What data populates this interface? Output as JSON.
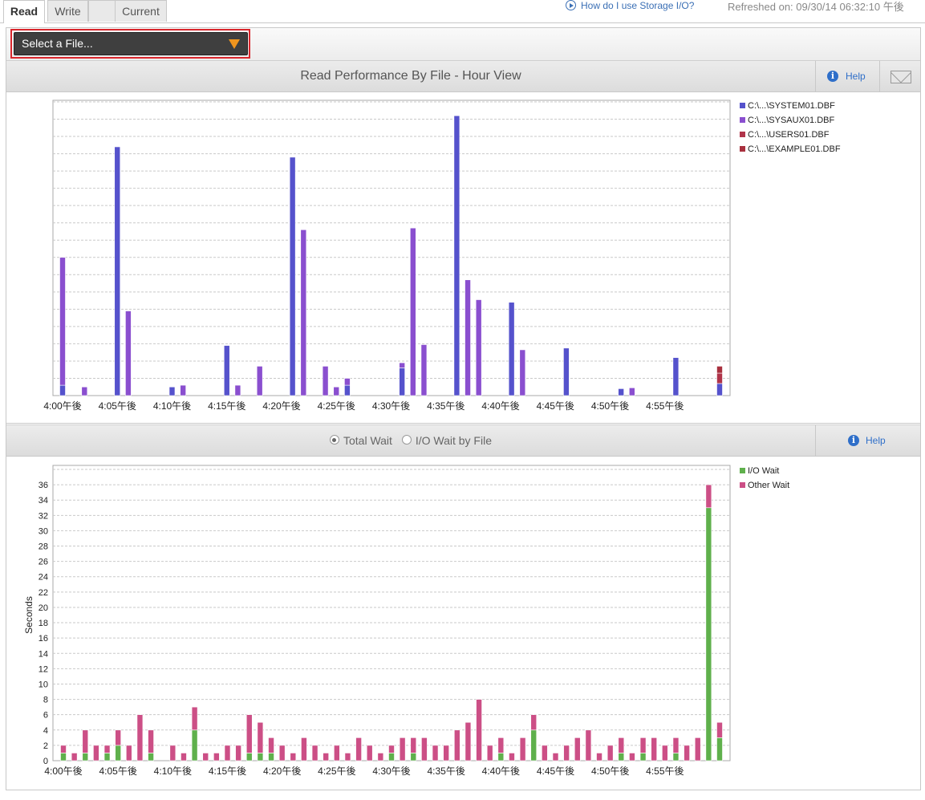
{
  "tabs": [
    {
      "label": "Read",
      "active": true
    },
    {
      "label": "Write",
      "active": false
    },
    {
      "label": "",
      "active": false
    },
    {
      "label": "Current",
      "active": false
    }
  ],
  "header": {
    "howto_label": "How do I use Storage I/O?",
    "refreshed": "Refreshed on: 09/30/14 06:32:10 午後"
  },
  "file_select": {
    "label": "Select a File..."
  },
  "read_panel": {
    "title": "Read Performance By File - Hour View",
    "help_label": "Help"
  },
  "wait_panel": {
    "radio_total": "Total Wait",
    "radio_by_file": "I/O Wait by File",
    "selected": "Total Wait",
    "help_label": "Help"
  },
  "colors": {
    "system": "#5552cc",
    "sysaux": "#8a4fcf",
    "users": "#b0344a",
    "example": "#a8303e",
    "io_wait": "#5fb04c",
    "other_wait": "#cc4f86"
  },
  "chart_data": [
    {
      "type": "bar",
      "title": "",
      "x_tick_labels": [
        "4:00午後",
        "4:05午後",
        "4:10午後",
        "4:15午後",
        "4:20午後",
        "4:25午後",
        "4:30午後",
        "4:35午後",
        "4:40午後",
        "4:45午後",
        "4:50午後",
        "4:55午後"
      ],
      "y_tick_labels_shown": false,
      "ylim": [
        0,
        17
      ],
      "grid": true,
      "legend_position": "top-right",
      "minutes": [
        0,
        1,
        2,
        3,
        4,
        5,
        6,
        7,
        8,
        9,
        10,
        11,
        12,
        13,
        14,
        15,
        16,
        17,
        18,
        19,
        20,
        21,
        22,
        23,
        24,
        25,
        26,
        27,
        28,
        29,
        30,
        31,
        32,
        33,
        34,
        35,
        36,
        37,
        38,
        39,
        40,
        41,
        42,
        43,
        44,
        45,
        46,
        47,
        48,
        49,
        50,
        51,
        52,
        53,
        54,
        55,
        56,
        57,
        58,
        59,
        60
      ],
      "series": [
        {
          "name": "C:\\...\\SYSTEM01.DBF",
          "values": [
            0.6,
            0,
            0,
            0,
            0,
            14.4,
            0,
            0,
            0,
            0,
            0.5,
            0,
            0,
            0,
            0,
            2.9,
            0,
            0,
            0,
            0,
            0,
            13.8,
            0,
            0,
            0,
            0,
            0.6,
            0,
            0,
            0,
            0,
            1.6,
            0,
            0,
            0,
            0,
            16.2,
            0,
            0,
            0,
            0,
            5.4,
            0,
            0,
            0,
            0,
            2.75,
            0,
            0,
            0,
            0,
            0.4,
            0,
            0,
            0,
            0,
            2.2,
            0,
            0,
            0,
            0.7
          ]
        },
        {
          "name": "C:\\...\\SYSAUX01.DBF",
          "values": [
            7.4,
            0,
            0.5,
            0,
            0,
            0,
            4.9,
            0,
            0,
            0,
            0,
            0.6,
            0,
            0,
            0,
            0,
            0.6,
            0,
            1.7,
            0,
            0,
            0,
            9.6,
            0,
            1.7,
            0.5,
            0.4,
            0,
            0,
            0,
            0,
            0.3,
            9.7,
            2.95,
            0,
            0,
            0,
            6.7,
            5.55,
            0,
            0,
            0,
            2.65,
            0,
            0,
            0,
            0,
            0,
            0,
            0,
            0,
            0,
            0.45,
            0,
            0,
            0,
            0,
            0,
            0,
            0,
            0
          ]
        },
        {
          "name": "C:\\...\\USERS01.DBF",
          "values": [
            0,
            0,
            0,
            0,
            0,
            0,
            0,
            0,
            0,
            0,
            0,
            0,
            0,
            0,
            0,
            0,
            0,
            0,
            0,
            0,
            0,
            0,
            0,
            0,
            0,
            0,
            0,
            0,
            0,
            0,
            0,
            0,
            0,
            0,
            0,
            0,
            0,
            0,
            0,
            0,
            0,
            0,
            0,
            0,
            0,
            0,
            0,
            0,
            0,
            0,
            0,
            0,
            0,
            0,
            0,
            0,
            0,
            0,
            0,
            0,
            0.6
          ]
        },
        {
          "name": "C:\\...\\EXAMPLE01.DBF",
          "values": [
            0,
            0,
            0,
            0,
            0,
            0,
            0,
            0,
            0,
            0,
            0,
            0,
            0,
            0,
            0,
            0,
            0,
            0,
            0,
            0,
            0,
            0,
            0,
            0,
            0,
            0,
            0,
            0,
            0,
            0,
            0,
            0,
            0,
            0,
            0,
            0,
            0,
            0,
            0,
            0,
            0,
            0,
            0,
            0,
            0,
            0,
            0,
            0,
            0,
            0,
            0,
            0,
            0,
            0,
            0,
            0,
            0,
            0,
            0,
            0,
            0.4
          ]
        }
      ]
    },
    {
      "type": "bar",
      "title": "",
      "ylabel": "Seconds",
      "ylim": [
        0,
        38
      ],
      "yticks": [
        0,
        2,
        4,
        6,
        8,
        10,
        12,
        14,
        16,
        18,
        20,
        22,
        24,
        26,
        28,
        30,
        32,
        34,
        36
      ],
      "x_tick_labels": [
        "4:00午後",
        "4:05午後",
        "4:10午後",
        "4:15午後",
        "4:20午後",
        "4:25午後",
        "4:30午後",
        "4:35午後",
        "4:40午後",
        "4:45午後",
        "4:50午後",
        "4:55午後"
      ],
      "grid": true,
      "legend_position": "top-right",
      "minutes": [
        0,
        1,
        2,
        3,
        4,
        5,
        6,
        7,
        8,
        9,
        10,
        11,
        12,
        13,
        14,
        15,
        16,
        17,
        18,
        19,
        20,
        21,
        22,
        23,
        24,
        25,
        26,
        27,
        28,
        29,
        30,
        31,
        32,
        33,
        34,
        35,
        36,
        37,
        38,
        39,
        40,
        41,
        42,
        43,
        44,
        45,
        46,
        47,
        48,
        49,
        50,
        51,
        52,
        53,
        54,
        55,
        56,
        57,
        58,
        59,
        60
      ],
      "series": [
        {
          "name": "I/O Wait",
          "values": [
            1,
            0,
            1,
            0,
            1,
            2,
            0,
            0,
            1,
            0,
            0,
            0,
            4,
            0,
            0,
            0,
            0,
            1,
            1,
            1,
            0,
            0,
            0,
            0,
            0,
            0,
            0,
            0,
            0,
            0,
            1,
            0,
            1,
            0,
            0,
            0,
            0,
            0,
            0,
            0,
            1,
            0,
            0,
            4,
            0,
            0,
            0,
            0,
            0,
            0,
            0,
            1,
            0,
            1,
            0,
            0,
            1,
            0,
            0,
            33,
            3
          ]
        },
        {
          "name": "Other Wait",
          "values": [
            1,
            1,
            3,
            2,
            1,
            2,
            2,
            6,
            3,
            0,
            2,
            1,
            3,
            1,
            1,
            2,
            2,
            5,
            4,
            2,
            2,
            1,
            3,
            2,
            1,
            2,
            1,
            3,
            2,
            1,
            1,
            3,
            2,
            3,
            2,
            2,
            4,
            5,
            8,
            2,
            2,
            1,
            3,
            2,
            2,
            1,
            2,
            3,
            4,
            1,
            2,
            2,
            1,
            2,
            3,
            2,
            2,
            2,
            3,
            3,
            2
          ]
        }
      ]
    }
  ]
}
